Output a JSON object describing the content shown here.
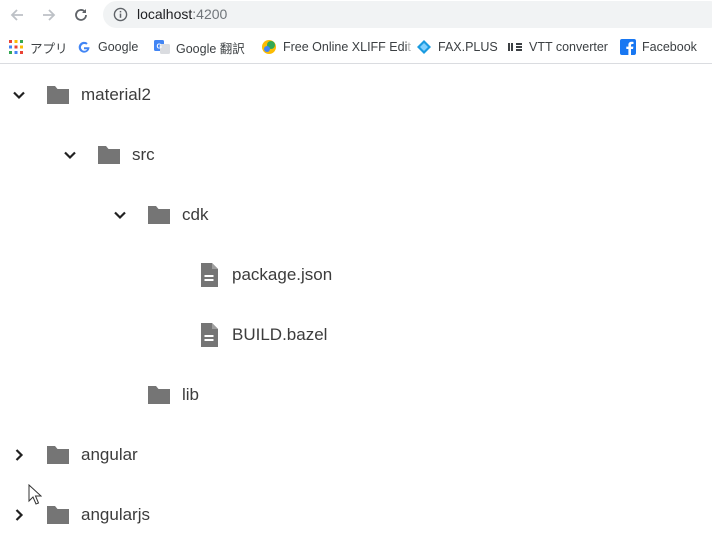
{
  "browser": {
    "url_host": "localhost",
    "url_port": ":4200"
  },
  "bookmarks": [
    {
      "label": "アプリ",
      "icon": "apps-grid-icon"
    },
    {
      "label": "Google",
      "icon": "google-g-icon"
    },
    {
      "label": "Google 翻訳",
      "icon": "google-translate-icon"
    },
    {
      "label": "Free Online XLIFF Edi",
      "label_fade": "t",
      "icon": "xliff-icon"
    },
    {
      "label": "FAX.PLUS",
      "icon": "faxplus-icon"
    },
    {
      "label": "VTT converter",
      "icon": "vtt-icon"
    },
    {
      "label": "Facebook",
      "icon": "facebook-icon"
    }
  ],
  "tree": {
    "nodes": [
      {
        "label": "material2",
        "type": "folder",
        "expanded": true
      },
      {
        "label": "src",
        "type": "folder",
        "expanded": true
      },
      {
        "label": "cdk",
        "type": "folder",
        "expanded": true
      },
      {
        "label": "package.json",
        "type": "file"
      },
      {
        "label": "BUILD.bazel",
        "type": "file"
      },
      {
        "label": "lib",
        "type": "folder"
      },
      {
        "label": "angular",
        "type": "folder",
        "expanded": false
      },
      {
        "label": "angularjs",
        "type": "folder",
        "expanded": false
      }
    ]
  },
  "colors": {
    "icon": "#757575",
    "text": "#3c3c3c",
    "omnibox": "#f1f3f4"
  }
}
